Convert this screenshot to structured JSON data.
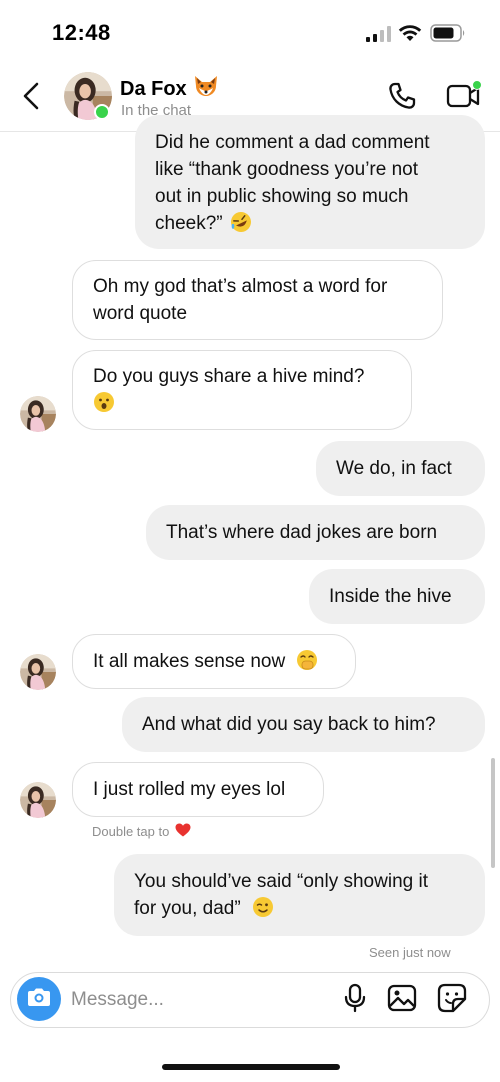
{
  "status_bar": {
    "time": "12:48",
    "icons": [
      "cellular-signal-icon",
      "wifi-icon",
      "battery-icon"
    ]
  },
  "header": {
    "contact_name": "Da Fox",
    "contact_emoji": "fox-emoji",
    "contact_status": "In the chat",
    "online": true,
    "icons": [
      "back-chevron-icon",
      "phone-icon",
      "video-camera-icon"
    ]
  },
  "messages": [
    {
      "direction": "sent",
      "lines": [
        "Did he comment a dad comment",
        "like “thank goodness you’re not",
        "out in public showing so much",
        "cheek?”"
      ],
      "emoji": "rofl-emoji"
    },
    {
      "direction": "received",
      "lines": [
        "Oh my god that’s almost a word for",
        "word quote"
      ]
    },
    {
      "direction": "received",
      "lines": [
        "Do you guys share a hive mind?"
      ],
      "emoji": "astonished-emoji",
      "avatar": true
    },
    {
      "direction": "sent",
      "lines": [
        "We do, in fact"
      ]
    },
    {
      "direction": "sent",
      "lines": [
        "That’s where dad jokes are born"
      ]
    },
    {
      "direction": "sent",
      "lines": [
        "Inside the hive"
      ]
    },
    {
      "direction": "received",
      "lines": [
        "It all makes sense now"
      ],
      "emoji": "hand-over-mouth-emoji",
      "avatar": true
    },
    {
      "direction": "sent",
      "lines": [
        "And what did you say back to him?"
      ]
    },
    {
      "direction": "received",
      "lines": [
        "I just rolled my eyes lol"
      ],
      "avatar": true
    },
    {
      "direction": "sent",
      "lines": [
        "You should’ve said “only showing it",
        "for you, dad”"
      ],
      "emoji": "wink-emoji"
    }
  ],
  "hints": {
    "double_tap": "Double tap to",
    "double_tap_icon": "red-heart-emoji",
    "seen": "Seen just now"
  },
  "composer": {
    "placeholder": "Message...",
    "icons": [
      "camera-icon",
      "microphone-icon",
      "gallery-icon",
      "sticker-icon"
    ]
  },
  "colors": {
    "accent_blue": "#3897f0",
    "online_green": "#39d34b",
    "sent_bubble": "#efefef",
    "received_border": "#dedede",
    "muted_text": "#8e8e8e"
  }
}
